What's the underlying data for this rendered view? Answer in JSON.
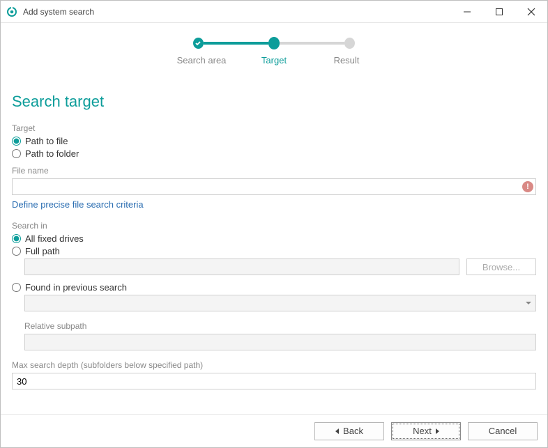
{
  "window": {
    "title": "Add system search"
  },
  "stepper": {
    "steps": [
      {
        "label": "Search area",
        "state": "done"
      },
      {
        "label": "Target",
        "state": "current"
      },
      {
        "label": "Result",
        "state": "pending"
      }
    ]
  },
  "heading": "Search target",
  "target": {
    "section_label": "Target",
    "options": {
      "path_to_file": "Path to file",
      "path_to_folder": "Path to folder"
    },
    "selected": "path_to_file"
  },
  "filename": {
    "label": "File name",
    "value": "",
    "has_error": true,
    "define_link": "Define precise file search criteria"
  },
  "search_in": {
    "section_label": "Search in",
    "options": {
      "all_fixed": "All fixed drives",
      "full_path": "Full path",
      "prev_search": "Found in previous search"
    },
    "selected": "all_fixed",
    "full_path_value": "",
    "browse_label": "Browse...",
    "prev_search_value": "",
    "relative_subpath_label": "Relative subpath",
    "relative_subpath_value": ""
  },
  "max_depth": {
    "label": "Max search depth (subfolders below specified path)",
    "value": "30"
  },
  "footer": {
    "back": "Back",
    "next": "Next",
    "cancel": "Cancel"
  }
}
